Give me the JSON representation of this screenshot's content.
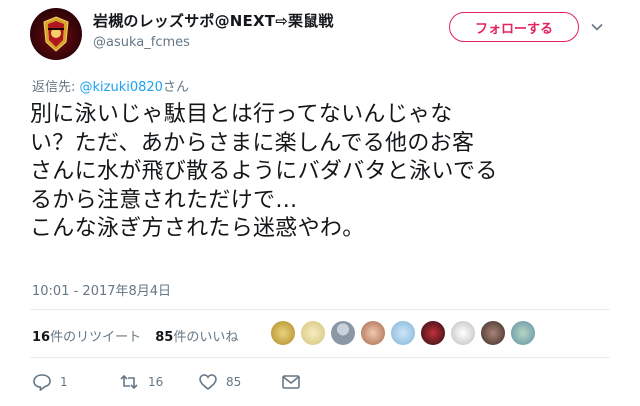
{
  "user": {
    "display_name": "岩槻のレッズサポ@NEXT⇨栗鼠戦",
    "handle": "@asuka_fcmes"
  },
  "follow_button_label": "フォローする",
  "reply_to": {
    "prefix": "返信先: ",
    "mention": "@kizuki0820",
    "suffix": "さん"
  },
  "tweet_text": "別に泳いじゃ駄目とは行ってないんじゃな\nい？ただ、あからさまに楽しんでる他のお客\nさんに水が飛び散るようにバダバタと泳いでる\nるから注意されただけで…\nこんな泳ぎ方されたら迷惑やわ。",
  "timestamp": "10:01 - 2017年8月4日",
  "stats": {
    "retweets_count": "16",
    "retweets_label": "件のリツイート",
    "likes_count": "85",
    "likes_label": "件のいいね"
  },
  "actions": {
    "reply_count": "1",
    "retweet_count": "16",
    "like_count": "85"
  },
  "icons": [
    "caret-down-icon",
    "reply-icon",
    "retweet-icon",
    "heart-icon",
    "mail-icon"
  ],
  "colors": {
    "follow_accent": "#e0245e",
    "link": "#1da1f2",
    "muted": "#657786"
  }
}
